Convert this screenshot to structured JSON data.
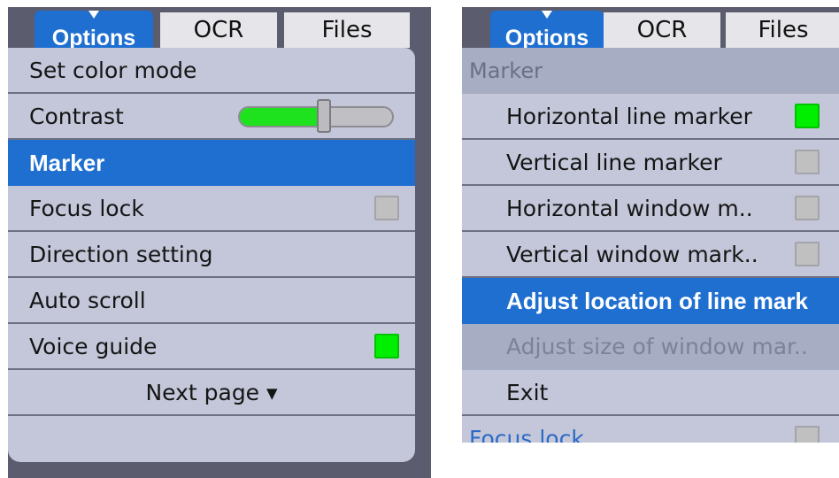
{
  "tabs": {
    "options": "Options",
    "ocr": "OCR",
    "files": "Files"
  },
  "left_menu": {
    "items": [
      {
        "label": "Set color mode"
      },
      {
        "label": "Contrast",
        "slider_value": 0.55
      },
      {
        "label": "Marker",
        "selected": true
      },
      {
        "label": "Focus lock",
        "checked": false
      },
      {
        "label": "Direction setting"
      },
      {
        "label": "Auto scroll"
      },
      {
        "label": "Voice guide",
        "checked": true
      }
    ],
    "next_page": "Next page ▾"
  },
  "right_menu": {
    "section": "Marker",
    "items": [
      {
        "label": "Horizontal line marker",
        "checked": true
      },
      {
        "label": "Vertical line marker",
        "checked": false
      },
      {
        "label": "Horizontal window m..",
        "checked": false
      },
      {
        "label": "Vertical window mark..",
        "checked": false
      },
      {
        "label": "Adjust location of line mark",
        "selected": true
      },
      {
        "label": "Adjust size of window mar..",
        "disabled": true
      },
      {
        "label": "Exit"
      }
    ],
    "focus_lock": "Focus lock"
  },
  "colors": {
    "accent": "#1f6fd0",
    "checked": "#00ee00",
    "background": "#5b5c6e",
    "menu": "#c3c7d9"
  }
}
